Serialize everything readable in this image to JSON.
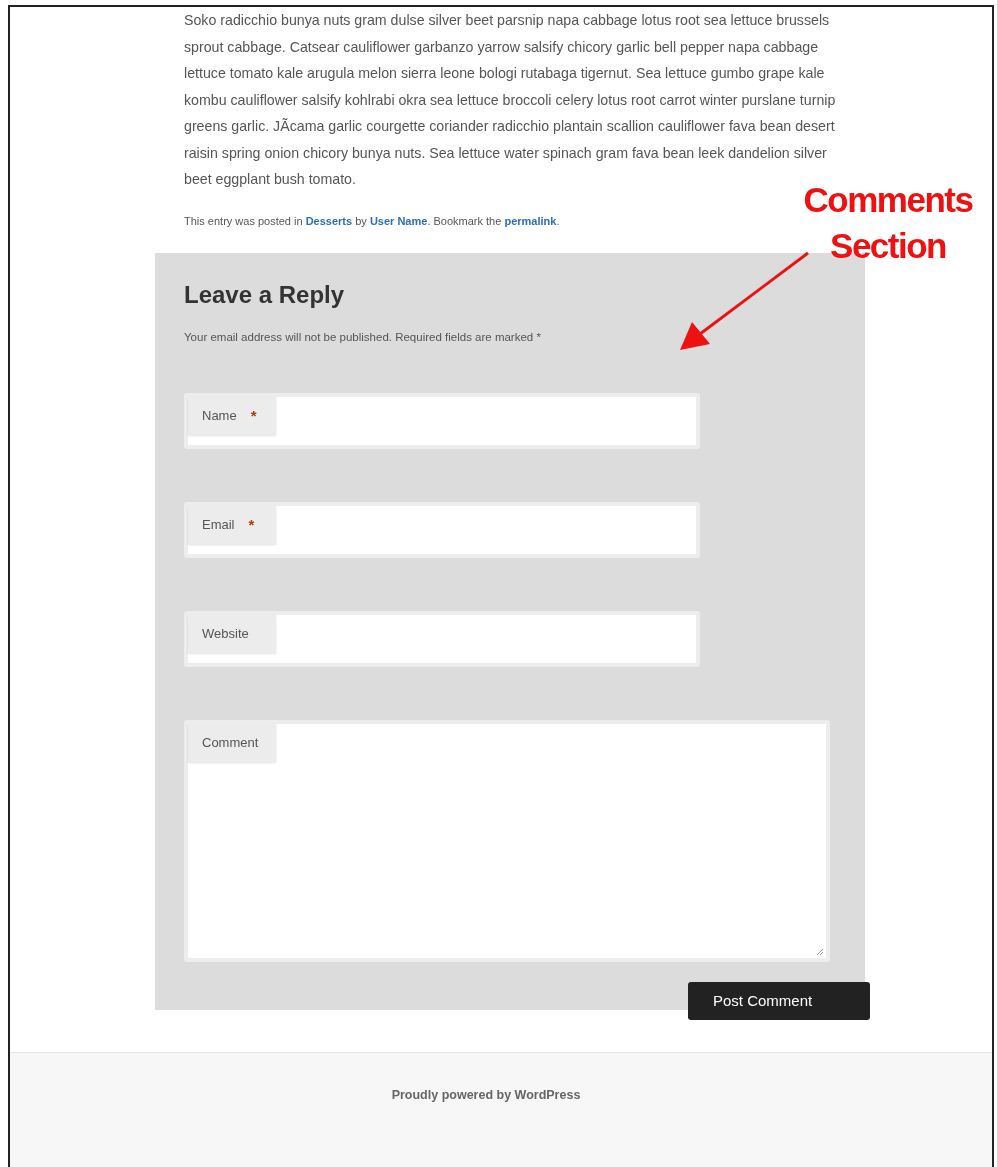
{
  "article": {
    "paragraph": "Soko radicchio bunya nuts gram dulse silver beet parsnip napa cabbage lotus root sea lettuce brussels sprout cabbage. Catsear cauliflower garbanzo yarrow salsify chicory garlic bell pepper napa cabbage lettuce tomato kale arugula melon sierra leone bologi rutabaga tigernut. Sea lettuce gumbo grape kale kombu cauliflower salsify kohlrabi okra sea lettuce broccoli celery lotus root carrot winter purslane turnip greens garlic. JÃcama garlic courgette coriander radicchio plantain scallion cauliflower fava bean desert raisin spring onion chicory bunya nuts. Sea lettuce water spinach gram fava bean leek dandelion silver beet eggplant bush tomato.",
    "meta": [
      {
        "kind": "text",
        "text": "This entry was posted in "
      },
      {
        "kind": "link",
        "text": "Desserts"
      },
      {
        "kind": "text",
        "text": " by "
      },
      {
        "kind": "link",
        "text": "User Name"
      },
      {
        "kind": "text",
        "text": ". Bookmark the "
      },
      {
        "kind": "link",
        "text": "permalink"
      },
      {
        "kind": "text",
        "text": "."
      }
    ]
  },
  "reply": {
    "title": "Leave a Reply",
    "note": "Your email address will not be published. Required fields are marked *",
    "required_mark": "*",
    "fields": [
      {
        "kind": "input",
        "label": "Name",
        "required": true
      },
      {
        "kind": "input",
        "label": "Email",
        "required": true
      },
      {
        "kind": "input",
        "label": "Website",
        "required": false
      },
      {
        "kind": "textarea",
        "label": "Comment",
        "required": false
      }
    ],
    "submit": "Post Comment"
  },
  "annotation": {
    "text": "Comments Section"
  },
  "footer": {
    "text": "Proudly powered by WordPress"
  }
}
